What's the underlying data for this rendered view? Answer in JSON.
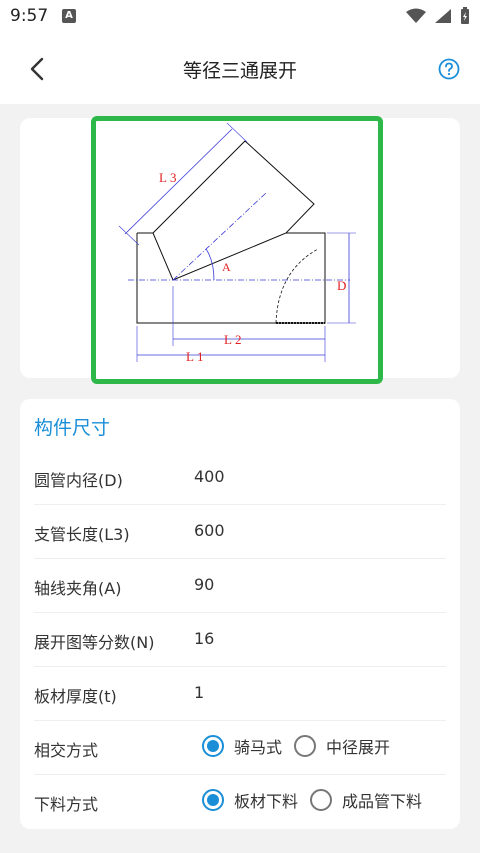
{
  "status_bar": {
    "time": "9:57",
    "notif_letter": "A"
  },
  "toolbar": {
    "title": "等径三通展开"
  },
  "diagram": {
    "labels": {
      "l3": "L3",
      "a": "A",
      "d": "D",
      "l2": "L2",
      "l1": "L1"
    },
    "highlight_color": "#2fb84a"
  },
  "form": {
    "section_title": "构件尺寸",
    "fields": [
      {
        "label": "圆管内径(D)",
        "value": "400"
      },
      {
        "label": "支管长度(L3)",
        "value": "600"
      },
      {
        "label": "轴线夹角(A)",
        "value": "90"
      },
      {
        "label": "展开图等分数(N)",
        "value": "16"
      },
      {
        "label": "板材厚度(t)",
        "value": "1"
      }
    ],
    "intersect": {
      "label": "相交方式",
      "options": [
        "骑马式",
        "中径展开"
      ],
      "selected": 0
    },
    "cutting": {
      "label": "下料方式",
      "options": [
        "板材下料",
        "成品管下料"
      ],
      "selected": 0
    }
  },
  "colors": {
    "accent": "#1a8fd8",
    "drawing_red": "#e02020",
    "drawing_blue": "#3a3ad8"
  }
}
